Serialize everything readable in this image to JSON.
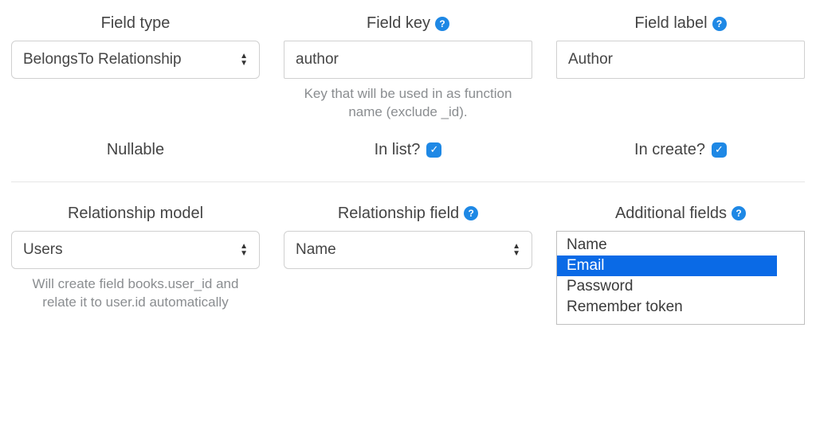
{
  "labels": {
    "field_type": "Field type",
    "field_key": "Field key",
    "field_label": "Field label",
    "nullable": "Nullable",
    "in_list": "In list?",
    "in_create": "In create?",
    "relationship_model": "Relationship model",
    "relationship_field": "Relationship field",
    "additional_fields": "Additional fields"
  },
  "field_type": {
    "value": "BelongsTo Relationship"
  },
  "field_key": {
    "value": "author",
    "helper": "Key that will be used in as function name (exclude _id)."
  },
  "field_label": {
    "value": "Author"
  },
  "checks": {
    "in_list": true,
    "in_create": true
  },
  "relationship_model": {
    "value": "Users",
    "helper": "Will create field books.user_id and relate it to user.id automatically"
  },
  "relationship_field": {
    "value": "Name"
  },
  "additional_fields": {
    "options": [
      "Name",
      "Email",
      "Password",
      "Remember token"
    ],
    "selected": "Email"
  },
  "help_glyph": "?",
  "check_glyph": "✓"
}
